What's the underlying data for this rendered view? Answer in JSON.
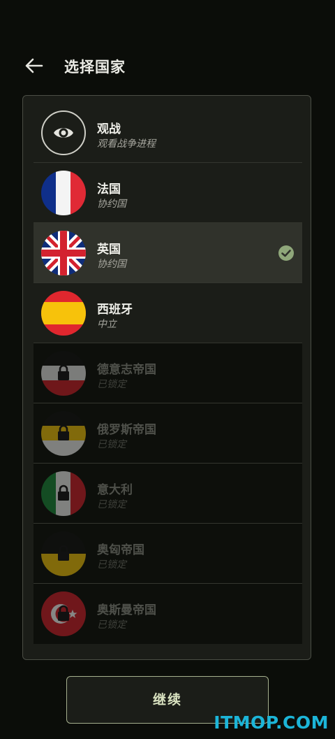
{
  "header": {
    "title": "选择国家"
  },
  "spectate": {
    "name": "观战",
    "subtitle": "观看战争进程"
  },
  "countries": [
    {
      "name": "法国",
      "status": "协约国",
      "locked": false
    },
    {
      "name": "英国",
      "status": "协约国",
      "locked": false,
      "selected": true
    },
    {
      "name": "西班牙",
      "status": "中立",
      "locked": false
    },
    {
      "name": "德意志帝国",
      "status": "已锁定",
      "locked": true
    },
    {
      "name": "俄罗斯帝国",
      "status": "已锁定",
      "locked": true
    },
    {
      "name": "意大利",
      "status": "已锁定",
      "locked": true
    },
    {
      "name": "奥匈帝国",
      "status": "已锁定",
      "locked": true
    },
    {
      "name": "奥斯曼帝国",
      "status": "已锁定",
      "locked": true
    }
  ],
  "continue_label": "继续",
  "watermark": "ITMOP.COM",
  "colors": {
    "accent": "#a6b08e",
    "check": "#8fa77a",
    "watermark": "#1cb5d8"
  }
}
